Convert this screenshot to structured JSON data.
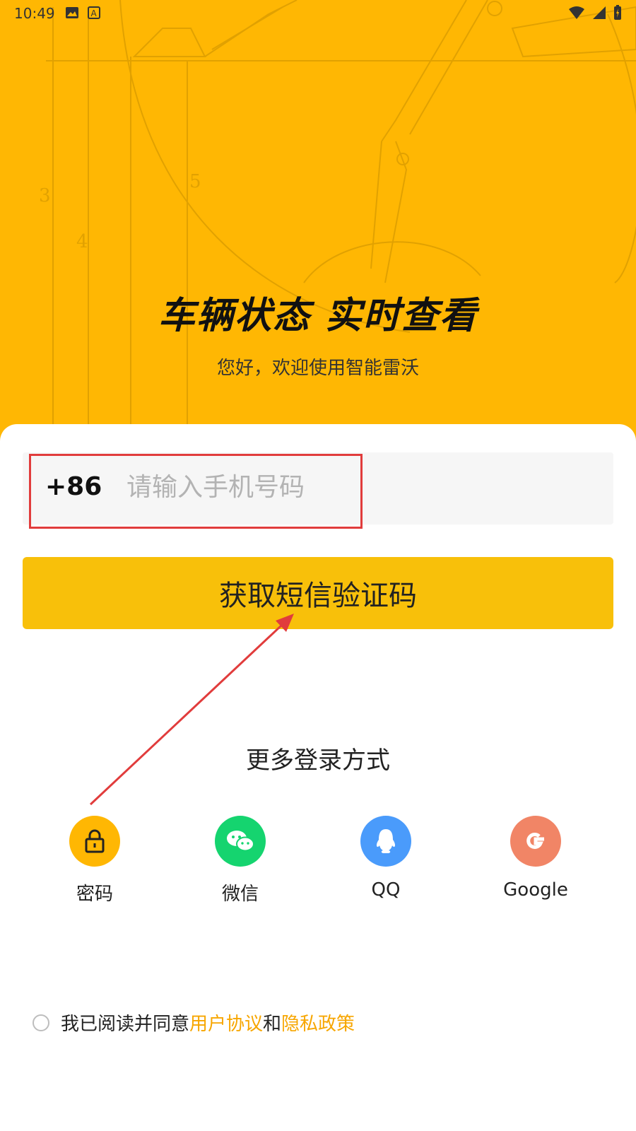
{
  "status_bar": {
    "time": "10:49",
    "left_icons": [
      "image-icon",
      "text-a-icon"
    ],
    "right_icons": [
      "wifi-icon",
      "signal-icon",
      "battery-icon"
    ]
  },
  "hero": {
    "title": "车辆状态 实时查看",
    "subtitle": "您好，欢迎使用智能雷沃",
    "background_color": "#FFB703"
  },
  "login": {
    "country_code": "+86",
    "phone_placeholder": "请输入手机号码",
    "phone_value": "",
    "sms_button_label": "获取短信验证码",
    "sms_button_color": "#F8C00A"
  },
  "more_login": {
    "title": "更多登录方式",
    "options": [
      {
        "label": "密码",
        "icon": "lock-icon",
        "color": "#FFB703"
      },
      {
        "label": "微信",
        "icon": "wechat-icon",
        "color": "#15D46F"
      },
      {
        "label": "QQ",
        "icon": "qq-icon",
        "color": "#4A9BFB"
      },
      {
        "label": "Google",
        "icon": "google-icon",
        "color": "#F18566"
      }
    ]
  },
  "agreement": {
    "prefix": "我已阅读并同意",
    "user_agreement": "用户协议",
    "conjunction": "和",
    "privacy_policy": "隐私政策",
    "link_color": "#F7A600"
  },
  "annotation": {
    "highlight_color": "#E13C3C"
  }
}
